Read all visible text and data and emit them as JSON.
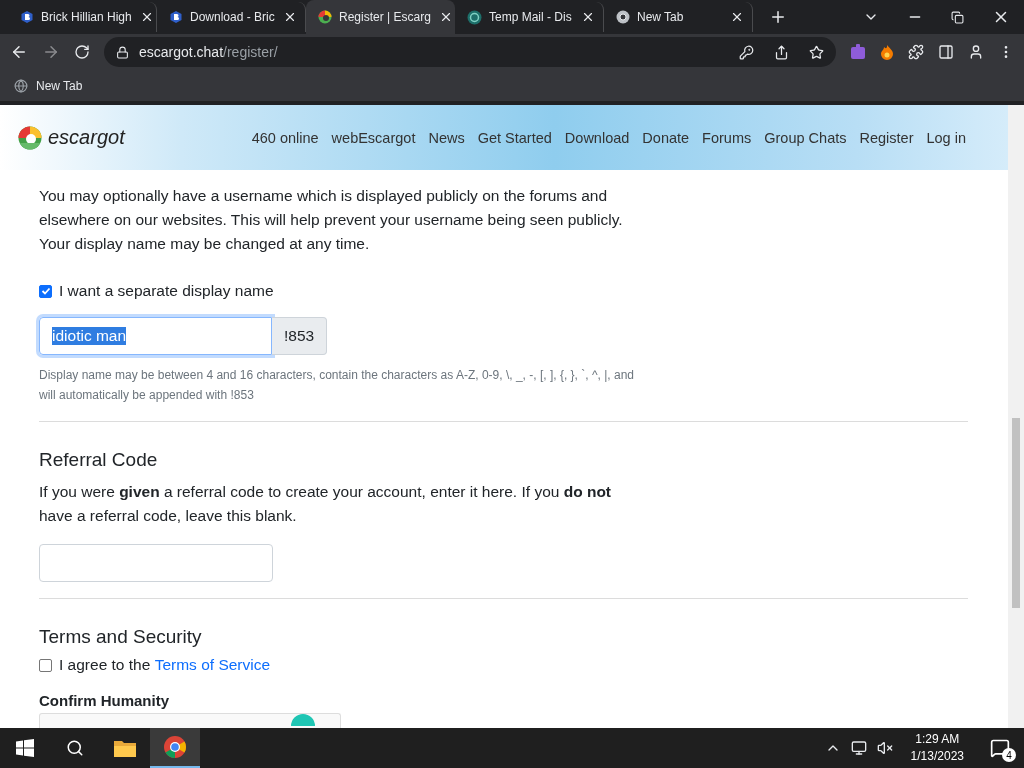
{
  "browser": {
    "tabs": [
      {
        "title": "Brick Hillian High",
        "kind": "brick",
        "selected": false
      },
      {
        "title": "Download - Bric",
        "kind": "brick",
        "selected": false
      },
      {
        "title": "Register | Escarg",
        "kind": "escargot",
        "selected": true
      },
      {
        "title": "Temp Mail - Dis",
        "kind": "tempmail",
        "selected": false
      },
      {
        "title": "New Tab",
        "kind": "chrome",
        "selected": false
      }
    ],
    "address": {
      "host": "escargot.chat",
      "path": "/register/"
    },
    "bookmarks": [
      {
        "label": "New Tab"
      }
    ]
  },
  "site_header": {
    "logo": "escargot",
    "links": [
      {
        "label": "460 online"
      },
      {
        "label": "webEscargot"
      },
      {
        "label": "News"
      },
      {
        "label": "Get Started"
      },
      {
        "label": "Download"
      },
      {
        "label": "Donate"
      },
      {
        "label": "Forums"
      },
      {
        "label": "Group Chats"
      },
      {
        "label": "Register"
      },
      {
        "label": "Log in"
      }
    ]
  },
  "display": {
    "text": "You may optionally have a username which is displayed publicly on the forums and elsewhere on our websites. This will help prevent your username being seen publicly. Your display name may be changed at any time.",
    "checkbox": {
      "label": "I want a separate display name",
      "checked": true
    },
    "field": {
      "value": "idiotic man",
      "value_selected": true,
      "focused": true
    },
    "suffix": "!853",
    "help": "Display name may be between 4 and 16 characters, contain the characters as A-Z, 0-9, \\, _, -, [, ], {, }, `, ^, |, and will automatically be appended with !853"
  },
  "referral": {
    "heading": "Referral Code",
    "text": "If you were **given** a referral code to create your account, enter it here. If you **do not** have a referral code, leave this blank."
  },
  "terms": {
    "heading": "Terms and Security",
    "checkbox": {
      "label": "I agree to the ",
      "link": "Terms of Service",
      "checked": false
    }
  },
  "humanity": {
    "heading": "Confirm Humanity"
  },
  "taskbar": {
    "time": "1:29 AM",
    "date": "1/13/2023",
    "notifications": "4"
  }
}
